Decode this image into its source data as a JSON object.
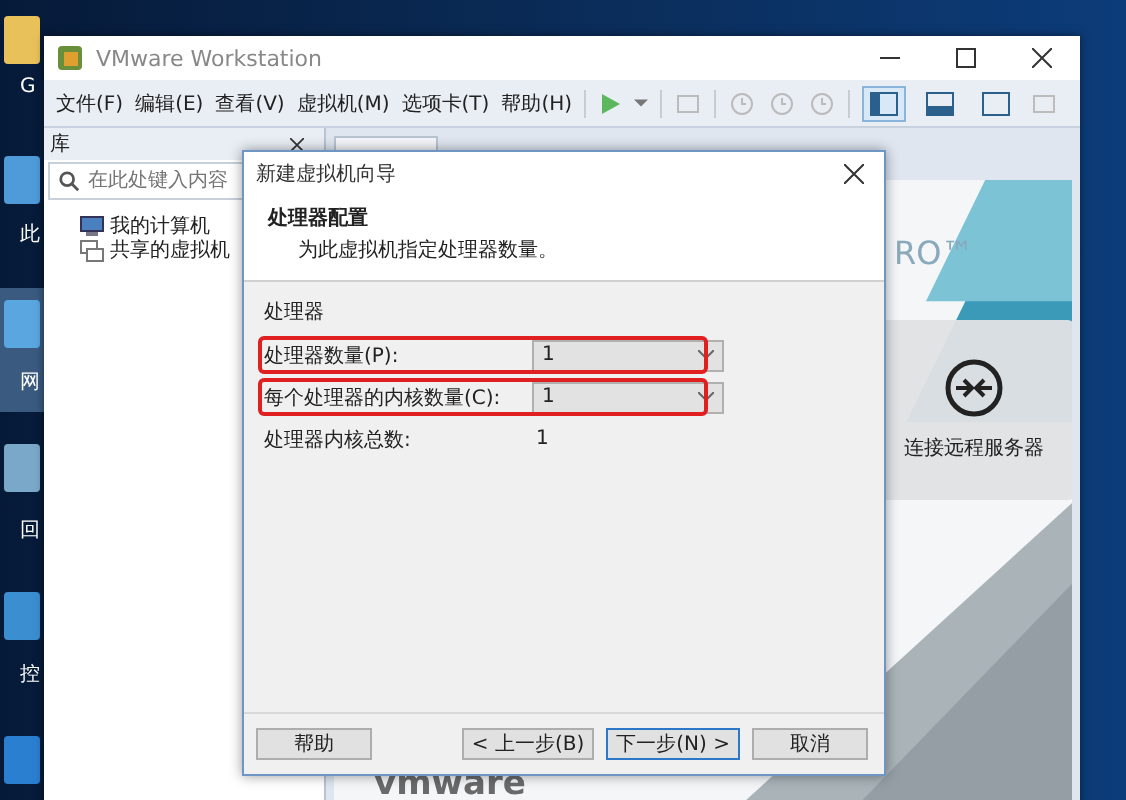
{
  "desktop_icons": [
    {
      "label": "G",
      "selected": false
    },
    {
      "label": "此",
      "selected": false
    },
    {
      "label": "网",
      "selected": true
    },
    {
      "label": "回",
      "selected": false
    },
    {
      "label": "控",
      "selected": false
    }
  ],
  "window": {
    "title": "VMware Workstation"
  },
  "menu": [
    "文件(F)",
    "编辑(E)",
    "查看(V)",
    "虚拟机(M)",
    "选项卡(T)",
    "帮助(H)"
  ],
  "view_buttons": [
    {
      "selected": true
    },
    {
      "selected": false
    },
    {
      "selected": false
    }
  ],
  "library": {
    "title": "库",
    "search": {
      "placeholder": "在此处键入内容"
    },
    "items": [
      {
        "label": "我的计算机",
        "kind": "computer"
      },
      {
        "label": "共享的虚拟机",
        "kind": "shared"
      }
    ]
  },
  "home": {
    "brand": "RO™",
    "remote_card": "连接远程服务器",
    "logo": "vmware"
  },
  "dialog": {
    "title": "新建虚拟机向导",
    "heading": "处理器配置",
    "subtitle": "为此虚拟机指定处理器数量。",
    "group": "处理器",
    "rows": [
      {
        "label": "处理器数量(P):",
        "kind": "dropdown",
        "value": "1",
        "highlighted": true
      },
      {
        "label": "每个处理器的内核数量(C):",
        "kind": "dropdown",
        "value": "1",
        "highlighted": true
      },
      {
        "label": "处理器内核总数:",
        "kind": "text",
        "value": "1",
        "highlighted": false
      }
    ],
    "buttons": [
      {
        "label": "帮助",
        "default": false
      },
      {
        "label": "< 上一步(B)",
        "default": false
      },
      {
        "label": "下一步(N) >",
        "default": true
      },
      {
        "label": "取消",
        "default": false
      }
    ]
  }
}
